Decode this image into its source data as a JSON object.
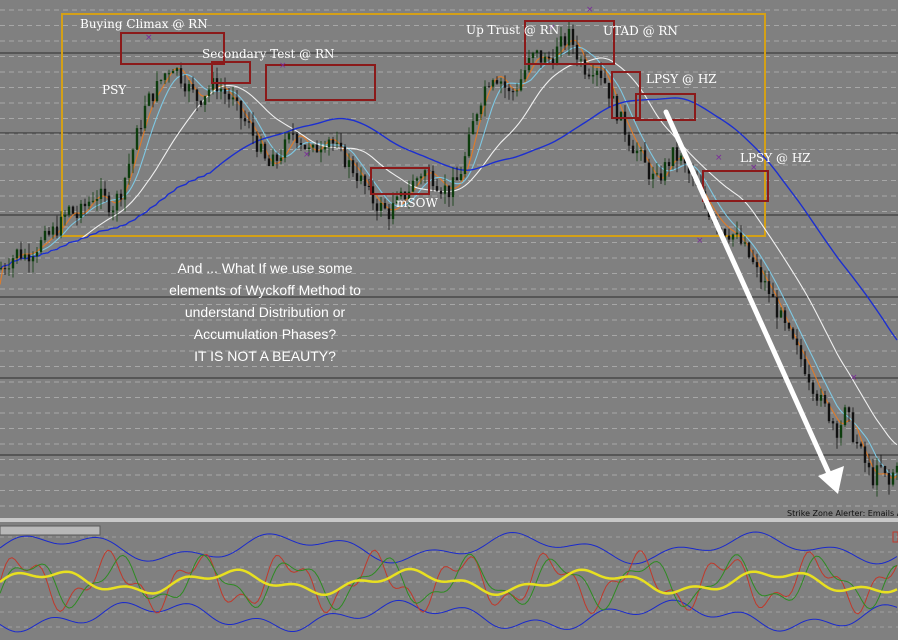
{
  "chart_data": [
    {
      "type": "line",
      "title": "",
      "chart_kind": "candlestick price chart with moving averages and Wyckoff annotations",
      "grid": true,
      "close_series": [
        12,
        18,
        25,
        22,
        28,
        33,
        40,
        46,
        58,
        52,
        62,
        70,
        66,
        60,
        72,
        95,
        118,
        140,
        150,
        162,
        170,
        160,
        150,
        142,
        150,
        155,
        148,
        140,
        128,
        120,
        105,
        90,
        96,
        106,
        118,
        110,
        100,
        108,
        115,
        104,
        96,
        88,
        78,
        66,
        60,
        55,
        63,
        70,
        80,
        88,
        84,
        76,
        72,
        80,
        100,
        130,
        150,
        163,
        158,
        146,
        154,
        168,
        178,
        172,
        176,
        185,
        192,
        175,
        165,
        170,
        158,
        140,
        125,
        110,
        100,
        88,
        78,
        90,
        100,
        95,
        82,
        70,
        58,
        48,
        42,
        38,
        30,
        18,
        5,
        -5,
        -20,
        -35,
        -48,
        -60,
        -75,
        -90,
        -100,
        -112,
        -98,
        -120,
        -135,
        -150,
        -142,
        -156,
        -132
      ],
      "moving_averages": [
        {
          "color": "#e07b28",
          "role": "fast"
        },
        {
          "color": "#7ec8e3",
          "role": "medium"
        },
        {
          "color": "#f0f0f0",
          "role": "slow"
        },
        {
          "color": "#1c2fd0",
          "role": "long"
        }
      ],
      "annotations": [
        {
          "text": "Buying Climax @ RN"
        },
        {
          "text": "Secondary Test @ RN"
        },
        {
          "text": "PSY"
        },
        {
          "text": "mSOW"
        },
        {
          "text": "Up Trust @ RN"
        },
        {
          "text": "UTAD @ RN"
        },
        {
          "text": "LPSY @ HZ"
        },
        {
          "text": "LPSY @ HZ"
        }
      ],
      "note_lines": [
        "And ... What If we use some",
        "elements of Wyckoff Method to",
        "understand Distribution or",
        "Accumulation Phases?",
        "IT IS NOT A BEAUTY?"
      ],
      "footer_text": "Strike Zone Alerter: Emails Alert"
    },
    {
      "type": "line",
      "title": "",
      "chart_kind": "oscillator subwindow with envelope bands",
      "grid": true,
      "series": [
        {
          "color": "#e8e020",
          "role": "signal"
        },
        {
          "color": "#1a2acc",
          "role": "upper-band"
        },
        {
          "color": "#1a2acc",
          "role": "lower-band"
        },
        {
          "color": "#c0392b",
          "role": "fast-oscillator"
        },
        {
          "color": "#2e8b22",
          "role": "slow-oscillator"
        }
      ]
    }
  ],
  "colors": {
    "background": "#808080",
    "grid": "#e8e8e8",
    "range_box": "#d4a017",
    "annotation_box": "#8b1a1a",
    "arrow": "#ffffff"
  }
}
